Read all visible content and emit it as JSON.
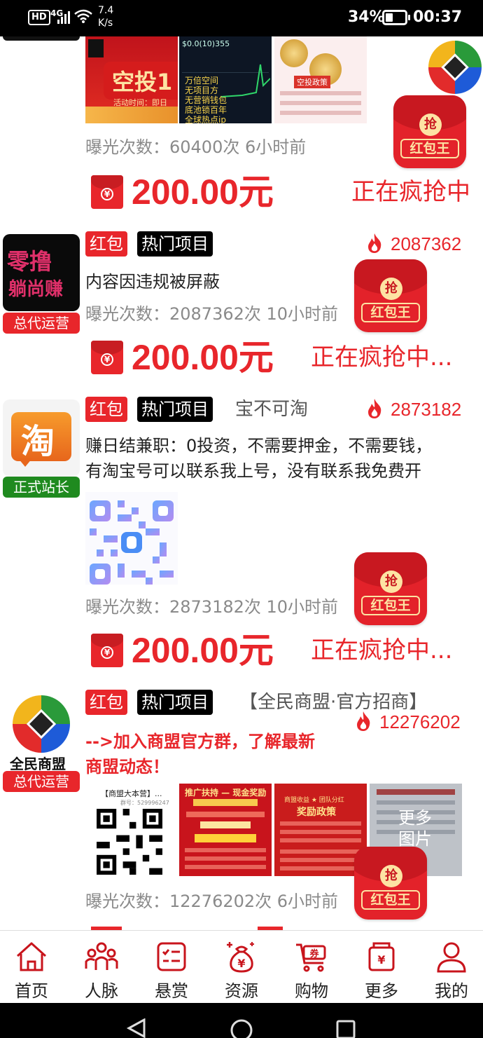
{
  "status_bar": {
    "hd": "HD",
    "network": "4G",
    "speed_value": "7.4",
    "speed_unit": "K/s",
    "battery": "34%",
    "time": "00:37"
  },
  "posts": [
    {
      "views": "曝光次数：60400次  6小时前",
      "amount": "200.00元",
      "status": "正在疯抢中",
      "thumb_texts": [
        "空投1",
        "活动时间：即日",
        "$0.0(10)355",
        "万倍空间",
        "无项目方",
        "无营销钱包",
        "底池锁百年",
        "全球热点ip",
        "空投政策"
      ]
    },
    {
      "avatar_text_1": "零撸",
      "avatar_text_2": "躺尚赚",
      "role": "总代运营",
      "tag_redpacket": "红包",
      "tag_hot": "热门项目",
      "heat": "2087362",
      "text": "内容因违规被屏蔽",
      "views": "曝光次数：2087362次  10小时前",
      "amount": "200.00元",
      "status": "正在疯抢中..."
    },
    {
      "avatar_text": "淘",
      "role": "正式站长",
      "tag_redpacket": "红包",
      "tag_hot": "热门项目",
      "poster": "宝不可淘",
      "heat": "2873182",
      "text_line1": "赚日结兼职：0投资，不需要押金，不需要钱，",
      "text_line2": "有淘宝号可以联系我上号，没有联系我免费开",
      "views": "曝光次数：2873182次  10小时前",
      "amount": "200.00元",
      "status": "正在疯抢中..."
    },
    {
      "avatar_text": "全民商盟",
      "role": "总代运营",
      "tag_redpacket": "红包",
      "tag_hot": "热门项目",
      "poster": "【全民商盟·官方招商】",
      "heat": "12276202",
      "text_line1": "-->加入商盟官方群，了解最新",
      "text_line2": "商盟动态！",
      "thumb_labels": [
        "【商盟大本营】...",
        "推广扶持 — 现金奖励",
        "奖励政策",
        "更多图片"
      ],
      "thumb_sub": [
        "群号：529996247",
        "商盟收益 ★ 团队分红"
      ],
      "views": "曝光次数：12276202次  6小时前"
    }
  ],
  "hongbao": {
    "qiang": "抢",
    "label": "红包王"
  },
  "bottom_nav": [
    {
      "label": "首页",
      "icon": "home-icon"
    },
    {
      "label": "人脉",
      "icon": "contacts-icon"
    },
    {
      "label": "悬赏",
      "icon": "reward-icon"
    },
    {
      "label": "资源",
      "icon": "resource-icon"
    },
    {
      "label": "购物",
      "icon": "shopping-cart-icon"
    },
    {
      "label": "更多",
      "icon": "more-icon"
    },
    {
      "label": "我的",
      "icon": "profile-icon"
    }
  ],
  "colors": {
    "accent": "#e8262b",
    "badge_red": "#e8262b",
    "badge_green": "#1f8a1f",
    "text_gray": "#8a8a8a"
  }
}
